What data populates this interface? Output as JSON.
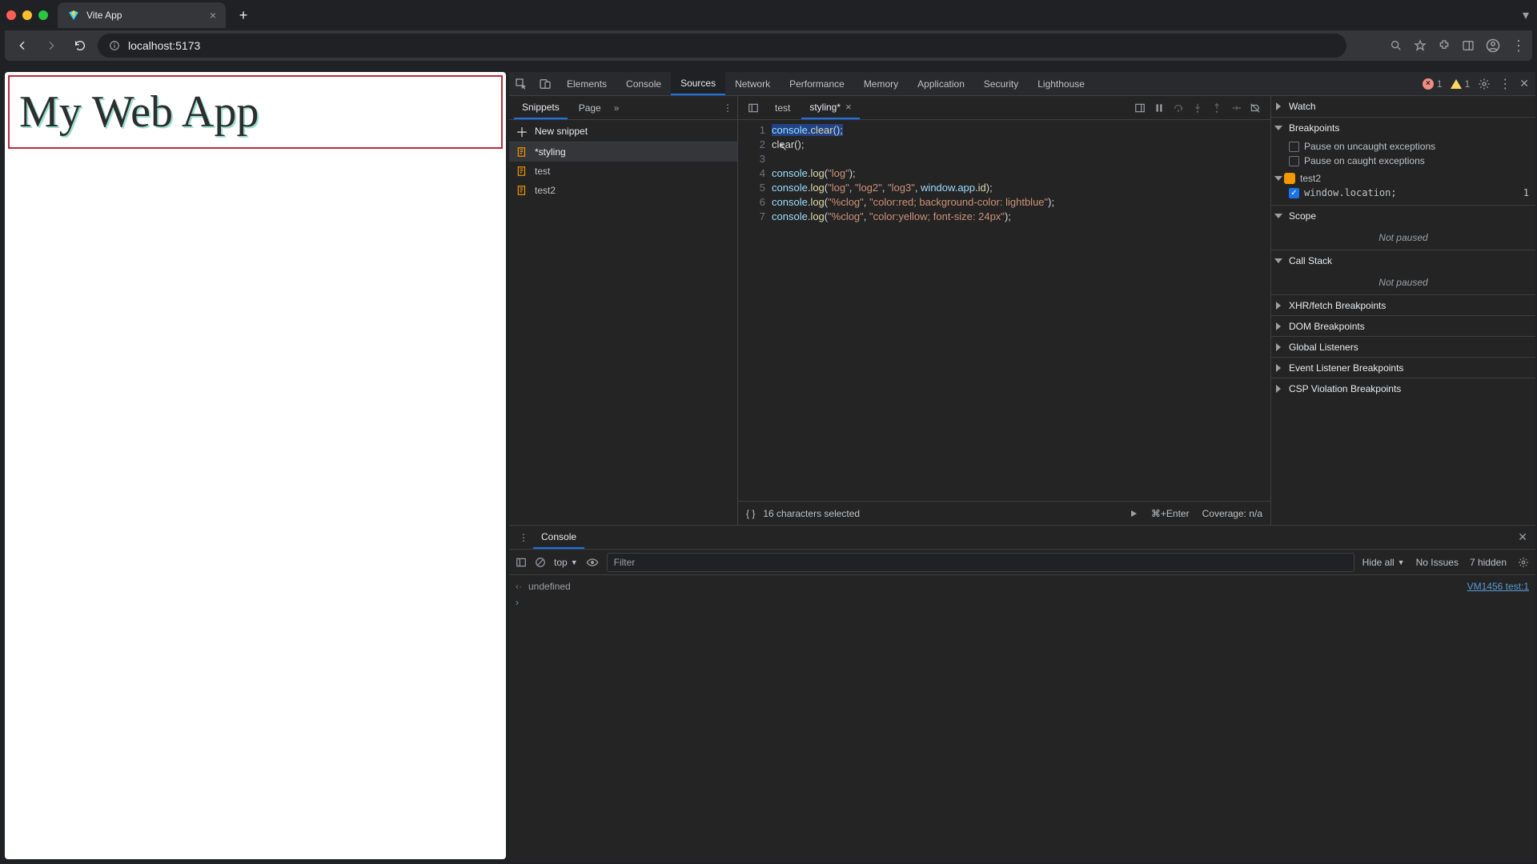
{
  "window_controls": {
    "close": "#ff5f57",
    "min": "#febc2e",
    "max": "#28c840"
  },
  "tab": {
    "title": "Vite App"
  },
  "address": {
    "url": "localhost:5173"
  },
  "page": {
    "heading": "My Web App"
  },
  "devtools": {
    "tabs": [
      "Elements",
      "Console",
      "Sources",
      "Network",
      "Performance",
      "Memory",
      "Application",
      "Security",
      "Lighthouse"
    ],
    "active_tab": "Sources",
    "errors": 1,
    "warnings": 1
  },
  "snippets": {
    "tabs": [
      "Snippets",
      "Page"
    ],
    "new_label": "New snippet",
    "items": [
      {
        "name": "*styling",
        "selected": true
      },
      {
        "name": "test",
        "selected": false
      },
      {
        "name": "test2",
        "selected": false
      }
    ]
  },
  "editor": {
    "open_tabs": [
      {
        "name": "test",
        "active": false
      },
      {
        "name": "styling*",
        "active": true
      }
    ],
    "lines": [
      "console.clear();",
      "clear();",
      "",
      "console.log(\"log\");",
      "console.log(\"log\", \"log2\", \"log3\", window.app.id);",
      "console.log(\"%clog\", \"color:red; background-color: lightblue\");",
      "console.log(\"%clog\", \"color:yellow; font-size: 24px\");"
    ],
    "selection_msg": "16 characters selected",
    "run_hint": "⌘+Enter",
    "coverage": "Coverage: n/a"
  },
  "debugger": {
    "watch": "Watch",
    "breakpoints": {
      "title": "Breakpoints",
      "uncaught": "Pause on uncaught exceptions",
      "caught": "Pause on caught exceptions",
      "group": "test2",
      "items": [
        {
          "label": "window.location;",
          "line": 1,
          "enabled": true
        }
      ]
    },
    "scope": {
      "title": "Scope",
      "msg": "Not paused"
    },
    "callstack": {
      "title": "Call Stack",
      "msg": "Not paused"
    },
    "sections": [
      "XHR/fetch Breakpoints",
      "DOM Breakpoints",
      "Global Listeners",
      "Event Listener Breakpoints",
      "CSP Violation Breakpoints"
    ]
  },
  "console": {
    "label": "Console",
    "context": "top",
    "filter_placeholder": "Filter",
    "levels": "Hide all",
    "issues": "No Issues",
    "hidden": "7 hidden",
    "rows": [
      {
        "text": "undefined",
        "source": "VM1456 test:1"
      }
    ]
  }
}
